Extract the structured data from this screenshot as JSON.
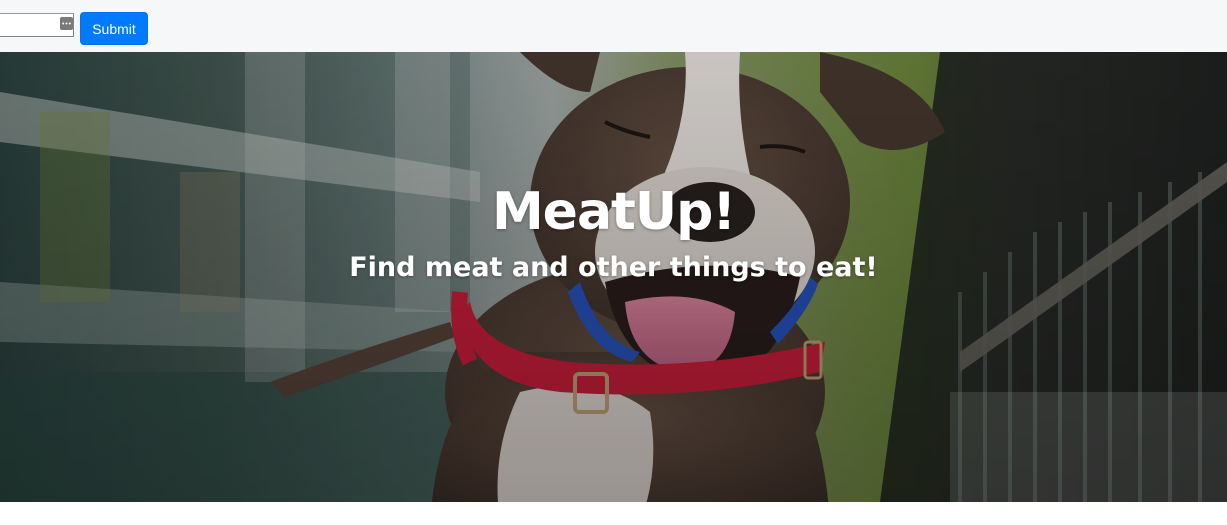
{
  "toolbar": {
    "search_value": "",
    "search_placeholder": "",
    "submit_label": "Submit"
  },
  "hero": {
    "title": "MeatUp!",
    "subtitle": "Find meat and other things to eat!"
  },
  "colors": {
    "topbar_bg": "#f6f7f9",
    "button_primary": "#007bff",
    "hero_text": "#ffffff",
    "collar_red": "#d3203c",
    "harness_blue": "#2a56c6"
  },
  "icons": {
    "input_icon": "password-dots-icon"
  }
}
